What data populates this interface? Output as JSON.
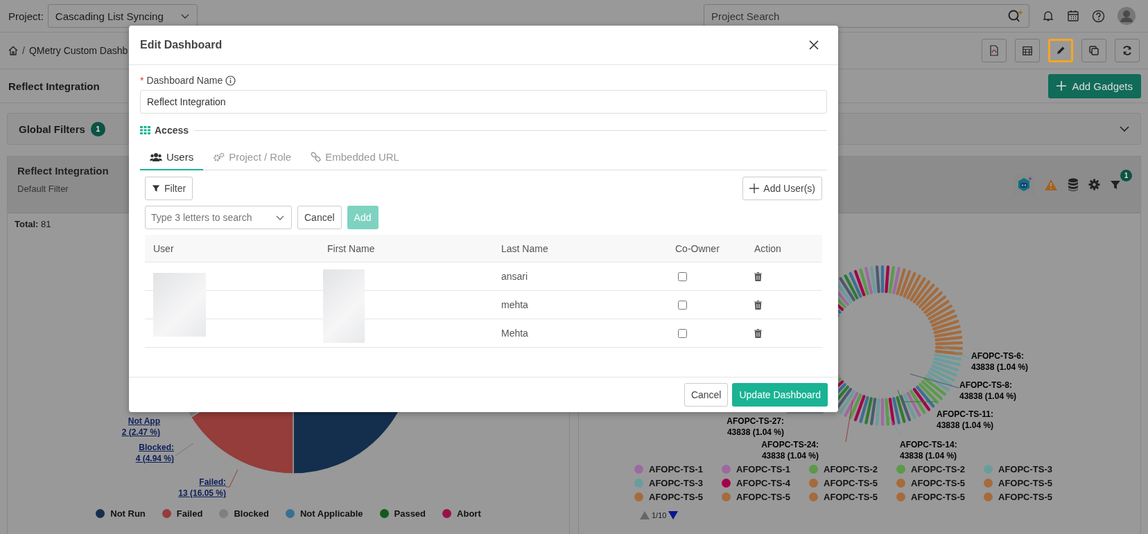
{
  "topbar": {
    "project_label": "Project:",
    "project": "Cascading List Syncing",
    "search": {
      "placeholder": "Project Search"
    }
  },
  "breadcrumb": {
    "separator": "/",
    "path": "QMetry Custom Dashb"
  },
  "toolbar": [
    {
      "kind": "pdf",
      "selected": false
    },
    {
      "kind": "calendar",
      "selected": false
    },
    {
      "kind": "edit",
      "selected": true
    },
    {
      "kind": "copy",
      "selected": false
    },
    {
      "kind": "refresh",
      "selected": false
    }
  ],
  "dashboard": {
    "title": "Reflect Integration",
    "add_button": "Add Gadgets"
  },
  "global_filters": {
    "label": "Global Filters",
    "count": "1"
  },
  "left_gadget": {
    "title": "Reflect Integration",
    "subtitle": "Default Filter",
    "total_label": "Total:",
    "total": "81",
    "pie_labels": [
      {
        "name": "Not App",
        "value": "2 (2.47 %)"
      },
      {
        "name": "Blocked:",
        "value": "4 (4.94 %)"
      },
      {
        "name": "Failed:",
        "value": "13 (16.05 %)"
      }
    ],
    "legend": [
      {
        "label": "Not Run",
        "color": "#142f4d"
      },
      {
        "label": "Failed",
        "color": "#943d3a"
      },
      {
        "label": "Blocked",
        "color": "#808080"
      },
      {
        "label": "Not Applicable",
        "color": "#3a6f94"
      },
      {
        "label": "Passed",
        "color": "#115a1c"
      },
      {
        "label": "Abort",
        "color": "#99104a"
      }
    ]
  },
  "right_gadget": {
    "filter_count": "1",
    "donut_labels": [
      {
        "name": "AFOPC-TS-6:",
        "value": "43838 (1.04 %)"
      },
      {
        "name": "AFOPC-TS-8:",
        "value": "43838 (1.04 %)"
      },
      {
        "name": "AFOPC-TS-27:",
        "value": "43838 (1.04 %)"
      },
      {
        "name": "AFOPC-TS-11:",
        "value": "43838 (1.04 %)"
      },
      {
        "name": "AFOPC-TS-24:",
        "value": "43838 (1.04 %)"
      },
      {
        "name": "AFOPC-TS-14:",
        "value": "43838 (1.04 %)"
      }
    ],
    "legend": [
      {
        "label": "AFOPC-TS-1",
        "color": "#9c6a9e"
      },
      {
        "label": "AFOPC-TS-1",
        "color": "#9c6a9e"
      },
      {
        "label": "AFOPC-TS-2",
        "color": "#5a9a4a"
      },
      {
        "label": "AFOPC-TS-2",
        "color": "#5a9a4a"
      },
      {
        "label": "AFOPC-TS-3",
        "color": "#6b9c9c"
      },
      {
        "label": "AFOPC-TS-3",
        "color": "#6b9c9c"
      },
      {
        "label": "AFOPC-TS-4",
        "color": "#a2004a"
      },
      {
        "label": "AFOPC-TS-5",
        "color": "#a56b3c"
      },
      {
        "label": "AFOPC-TS-5",
        "color": "#a56b3c"
      },
      {
        "label": "AFOPC-TS-5",
        "color": "#a56b3c"
      },
      {
        "label": "AFOPC-TS-5",
        "color": "#a56b3c"
      },
      {
        "label": "AFOPC-TS-5",
        "color": "#a56b3c"
      },
      {
        "label": "AFOPC-TS-5",
        "color": "#a56b3c"
      },
      {
        "label": "AFOPC-TS-5",
        "color": "#a56b3c"
      },
      {
        "label": "AFOPC-TS-5",
        "color": "#a56b3c"
      }
    ],
    "pager": "1/10"
  },
  "modal": {
    "title": "Edit Dashboard",
    "name_label": "Dashboard Name",
    "required_mark": "*",
    "name_value": "Reflect Integration",
    "access_label": "Access",
    "tabs": [
      {
        "label": "Users",
        "kind": "users",
        "selected": true
      },
      {
        "label": "Project / Role",
        "kind": "roles",
        "selected": false
      },
      {
        "label": "Embedded URL",
        "kind": "link",
        "selected": false
      }
    ],
    "filter_button": "Filter",
    "add_users_button": "Add User(s)",
    "user_search": {
      "placeholder": "Type 3 letters to search"
    },
    "cancel_button": "Cancel",
    "add_button": {
      "label": "Add",
      "disabled": true
    },
    "columns": [
      "User",
      "First Name",
      "Last Name",
      "Co-Owner",
      "Action"
    ],
    "rows": [
      {
        "last_name": "ansari",
        "co_owner": false
      },
      {
        "last_name": "mehta",
        "co_owner": false
      },
      {
        "last_name": "Mehta",
        "co_owner": false
      }
    ],
    "footer_cancel": "Cancel",
    "update_button": "Update Dashboard"
  }
}
